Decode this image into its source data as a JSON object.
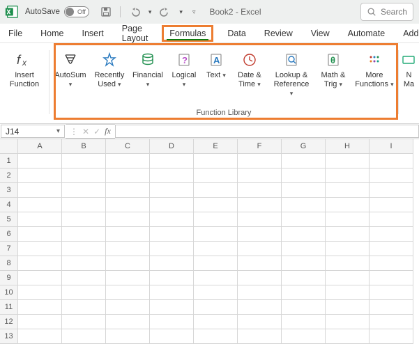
{
  "titlebar": {
    "autosave_label": "AutoSave",
    "autosave_state": "Off",
    "doc_title": "Book2  -  Excel",
    "search_label": "Search"
  },
  "tabs": {
    "items": [
      "File",
      "Home",
      "Insert",
      "Page Layout",
      "Formulas",
      "Data",
      "Review",
      "View",
      "Automate",
      "Add"
    ],
    "active_index": 4
  },
  "ribbon": {
    "insert_function": {
      "line1": "Insert",
      "line2": "Function"
    },
    "function_library": {
      "label": "Function Library",
      "items": [
        {
          "label": "AutoSum",
          "dropdown": true
        },
        {
          "label": "Recently Used",
          "dropdown": true,
          "multiline": [
            "Recently",
            "Used"
          ]
        },
        {
          "label": "Financial",
          "dropdown": true
        },
        {
          "label": "Logical",
          "dropdown": true
        },
        {
          "label": "Text",
          "dropdown": true
        },
        {
          "label": "Date & Time",
          "dropdown": true,
          "multiline": [
            "Date &",
            "Time"
          ]
        },
        {
          "label": "Lookup & Reference",
          "dropdown": true,
          "multiline": [
            "Lookup &",
            "Reference"
          ]
        },
        {
          "label": "Math & Trig",
          "dropdown": true,
          "multiline": [
            "Math &",
            "Trig"
          ]
        },
        {
          "label": "More Functions",
          "dropdown": true,
          "multiline": [
            "More",
            "Functions"
          ]
        }
      ]
    },
    "name_manager": {
      "line1": "N",
      "line2": "Ma"
    }
  },
  "formula_bar": {
    "name_box": "J14",
    "fx_label": "fx"
  },
  "grid": {
    "columns": [
      "A",
      "B",
      "C",
      "D",
      "E",
      "F",
      "G",
      "H",
      "I"
    ],
    "rows": [
      "1",
      "2",
      "3",
      "4",
      "5",
      "6",
      "7",
      "8",
      "9",
      "10",
      "11",
      "12",
      "13"
    ]
  },
  "highlight": {
    "color": "#ed7d31"
  }
}
